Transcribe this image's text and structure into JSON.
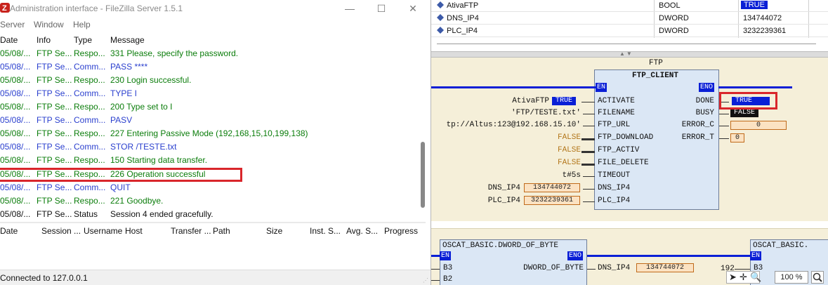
{
  "filezilla": {
    "title": "Administration interface - FileZilla Server 1.5.1",
    "window_buttons": {
      "minimize": "—",
      "maximize": "☐",
      "close": "✕"
    },
    "menu": [
      "Server",
      "Window",
      "Help"
    ],
    "log_headers": {
      "date": "Date",
      "info": "Info",
      "type": "Type",
      "message": "Message"
    },
    "log_rows": [
      {
        "date": "05/08/...",
        "info": "FTP Se...",
        "type": "Respo...",
        "message": "331 Please, specify the password.",
        "kind": "resp"
      },
      {
        "date": "05/08/...",
        "info": "FTP Se...",
        "type": "Comm...",
        "message": "PASS ****",
        "kind": "cmd"
      },
      {
        "date": "05/08/...",
        "info": "FTP Se...",
        "type": "Respo...",
        "message": "230 Login successful.",
        "kind": "resp"
      },
      {
        "date": "05/08/...",
        "info": "FTP Se...",
        "type": "Comm...",
        "message": "TYPE I",
        "kind": "cmd"
      },
      {
        "date": "05/08/...",
        "info": "FTP Se...",
        "type": "Respo...",
        "message": "200 Type set to I",
        "kind": "resp"
      },
      {
        "date": "05/08/...",
        "info": "FTP Se...",
        "type": "Comm...",
        "message": "PASV",
        "kind": "cmd"
      },
      {
        "date": "05/08/...",
        "info": "FTP Se...",
        "type": "Respo...",
        "message": "227 Entering Passive Mode (192,168,15,10,199,138)",
        "kind": "resp"
      },
      {
        "date": "05/08/...",
        "info": "FTP Se...",
        "type": "Comm...",
        "message": "STOR /TESTE.txt",
        "kind": "cmd"
      },
      {
        "date": "05/08/...",
        "info": "FTP Se...",
        "type": "Respo...",
        "message": "150 Starting data transfer.",
        "kind": "resp"
      },
      {
        "date": "05/08/...",
        "info": "FTP Se...",
        "type": "Respo...",
        "message": "226 Operation successful",
        "kind": "resp"
      },
      {
        "date": "05/08/...",
        "info": "FTP Se...",
        "type": "Comm...",
        "message": "QUIT",
        "kind": "cmd"
      },
      {
        "date": "05/08/...",
        "info": "FTP Se...",
        "type": "Respo...",
        "message": "221 Goodbye.",
        "kind": "resp"
      },
      {
        "date": "05/08/...",
        "info": "FTP Se...",
        "type": "Status",
        "message": "Session 4 ended gracefully.",
        "kind": "stat"
      }
    ],
    "session_headers": [
      "Date",
      "Session ...",
      "Username",
      "Host",
      "Transfer ...",
      "Path",
      "Size",
      "Inst. S...",
      "Avg. S...",
      "Progress"
    ],
    "status": "Connected to 127.0.0.1"
  },
  "plc": {
    "variables": [
      {
        "name": "AtivaFTP",
        "type": "BOOL",
        "value": "TRUE"
      },
      {
        "name": "DNS_IP4",
        "type": "DWORD",
        "value": "134744072"
      },
      {
        "name": "PLC_IP4",
        "type": "DWORD",
        "value": "3232239361"
      }
    ],
    "network1": {
      "instance": "FTP",
      "block_type": "FTP_CLIENT",
      "en": "EN",
      "eno": "ENO",
      "inputs": [
        {
          "pin": "ACTIVATE",
          "arg": "AtivaFTP",
          "value": "TRUE"
        },
        {
          "pin": "FILENAME",
          "arg": "'FTP/TESTE.txt'"
        },
        {
          "pin": "FTP_URL",
          "arg": "tp://Altus:123@192.168.15.10'"
        },
        {
          "pin": "FTP_DOWNLOAD",
          "arg": "FALSE"
        },
        {
          "pin": "FTP_ACTIV",
          "arg": "FALSE"
        },
        {
          "pin": "FILE_DELETE",
          "arg": "FALSE"
        },
        {
          "pin": "TIMEOUT",
          "arg": "t#5s"
        },
        {
          "pin": "DNS_IP4",
          "arg": "DNS_IP4",
          "value": "134744072"
        },
        {
          "pin": "PLC_IP4",
          "arg": "PLC_IP4",
          "value": "3232239361"
        }
      ],
      "outputs": [
        {
          "pin": "DONE",
          "value": "TRUE"
        },
        {
          "pin": "BUSY",
          "value": "FALSE"
        },
        {
          "pin": "ERROR_C",
          "value": "0"
        },
        {
          "pin": "ERROR_T",
          "value": "0"
        }
      ]
    },
    "network2": {
      "block1": "OSCAT_BASIC.DWORD_OF_BYTE",
      "block2": "OSCAT_BASIC.",
      "en": "EN",
      "eno": "ENO",
      "pin_b3": "B3",
      "pin_b2": "B2",
      "output_label": "DWORD_OF_BYTE",
      "output_arg": "DNS_IP4",
      "output_value": "134744072",
      "next_arg": "192",
      "next_en": "EN",
      "next_pin": "B3"
    },
    "zoom": "100 %"
  }
}
